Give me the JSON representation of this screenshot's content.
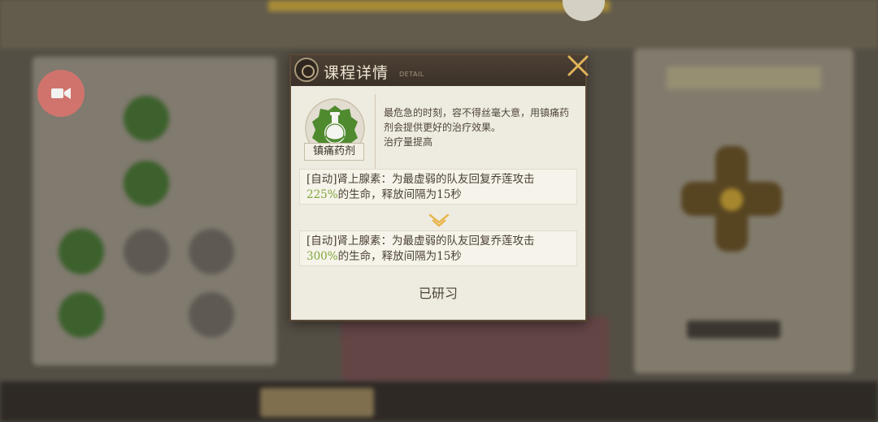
{
  "dialog": {
    "title": "课程详情",
    "subtitle": "DETAIL",
    "item_name": "镇痛药剂",
    "item_icon": "potion-flask-icon",
    "description_line1": "最危急的时刻，容不得丝毫大意，用镇痛药剂会提供更好的治疗效果。",
    "description_line2": "治疗量提高",
    "effect_before": {
      "prefix": "[自动]肾上腺素：为最虚弱的队友回复乔莲攻击",
      "percent": "225%",
      "suffix": "的生命，释放间隔为15秒"
    },
    "effect_after": {
      "prefix": "[自动]肾上腺素：为最虚弱的队友回复乔莲攻击",
      "percent": "300%",
      "suffix": "的生命，释放间隔为15秒"
    },
    "status": "已研习"
  },
  "colors": {
    "accent_green": "#7ea63a",
    "header_brown": "#3b3128",
    "close_gold": "#e0b45a",
    "camera_red": "#d9736d"
  },
  "icons": {
    "close": "close-icon",
    "camera": "video-camera-icon",
    "arrow": "chevron-down-icon",
    "emblem": "emblem-icon"
  }
}
